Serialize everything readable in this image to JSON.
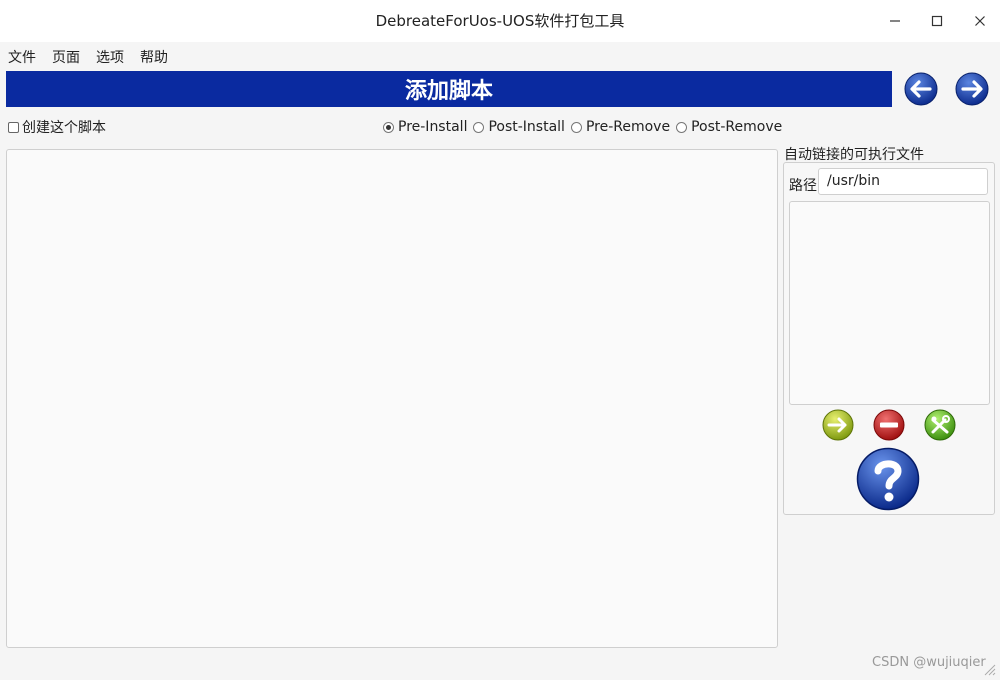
{
  "window": {
    "title": "DebreateForUos-UOS软件打包工具"
  },
  "menu": {
    "items": [
      "文件",
      "页面",
      "选项",
      "帮助"
    ]
  },
  "banner": {
    "title": "添加脚本"
  },
  "script": {
    "create_label": "创建这个脚本",
    "create_checked": false,
    "types": [
      {
        "label": "Pre-Install",
        "checked": true
      },
      {
        "label": "Post-Install",
        "checked": false
      },
      {
        "label": "Pre-Remove",
        "checked": false
      },
      {
        "label": "Post-Remove",
        "checked": false
      }
    ],
    "editor_value": ""
  },
  "autolink": {
    "group_title": "自动链接的可执行文件",
    "path_label": "路径",
    "path_value": "/usr/bin"
  },
  "watermark": "CSDN @wujiuqier",
  "icons": {
    "close": "close-icon",
    "maximize": "maximize-icon",
    "minimize": "minimize-icon",
    "back": "arrow-left-icon",
    "forward": "arrow-right-icon",
    "add": "add-arrow-icon",
    "remove": "remove-icon",
    "edit": "tools-icon",
    "help": "help-icon"
  },
  "colors": {
    "banner": "#0a2aa0",
    "nav_blue": "#1a44b8",
    "add_green": "#9bbd1a",
    "remove_red": "#cc2020",
    "tools_green": "#5cb81a"
  }
}
